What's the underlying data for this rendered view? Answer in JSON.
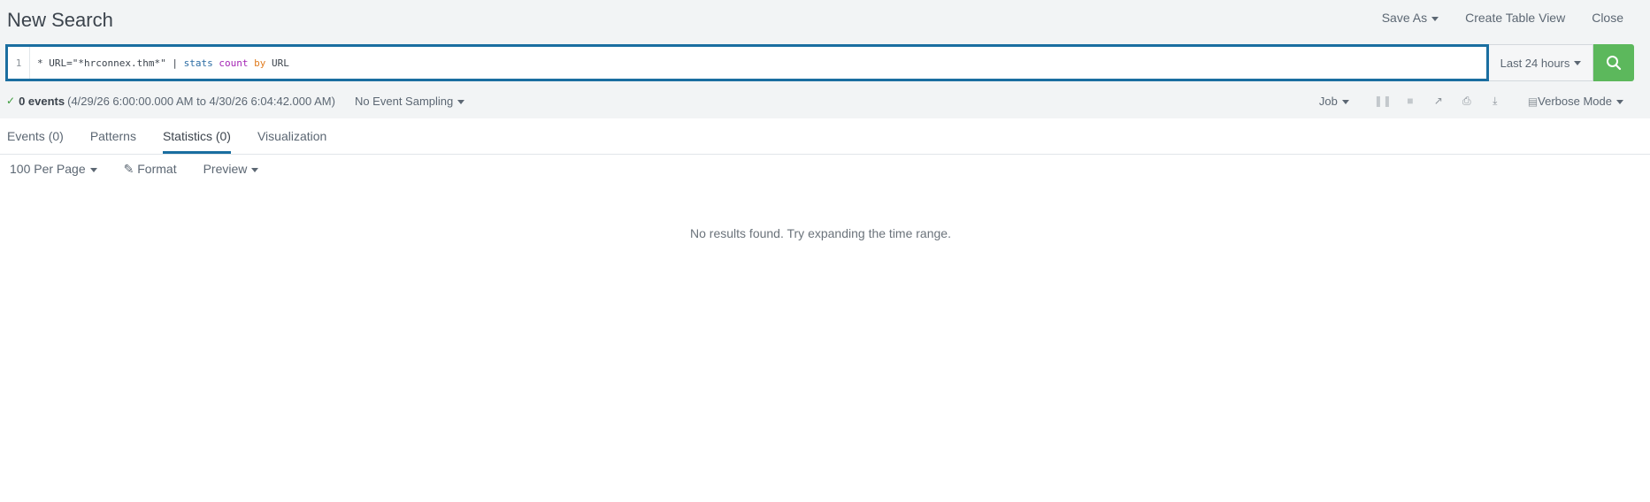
{
  "header": {
    "title": "New Search",
    "actions": [
      "Save As",
      "Create Table View",
      "Close"
    ]
  },
  "search": {
    "line_number": "1",
    "query_parts": [
      {
        "text": "* URL=\"*hrconnex.thm*\" | ",
        "type": "plain"
      },
      {
        "text": "stats",
        "type": "cmd"
      },
      {
        "text": " ",
        "type": "plain"
      },
      {
        "text": "count",
        "type": "fn"
      },
      {
        "text": " ",
        "type": "plain"
      },
      {
        "text": "by",
        "type": "kw"
      },
      {
        "text": " URL",
        "type": "plain"
      }
    ],
    "time_range": "Last 24 hours"
  },
  "status": {
    "events_count": "0 events",
    "time_span": "(4/29/26 6:00:00.000 AM to 4/30/26 6:04:42.000 AM)",
    "sampling": "No Event Sampling",
    "job": "Job",
    "mode": "Verbose Mode"
  },
  "tabs": [
    {
      "label": "Events (0)",
      "active": false
    },
    {
      "label": "Patterns",
      "active": false
    },
    {
      "label": "Statistics (0)",
      "active": true
    },
    {
      "label": "Visualization",
      "active": false
    }
  ],
  "toolbar": {
    "per_page": "100 Per Page",
    "format": "Format",
    "preview": "Preview"
  },
  "results": {
    "message": "No results found. Try expanding the time range."
  },
  "colors": {
    "accent": "#1a6ea0",
    "search_button": "#5cb85c",
    "success": "#3a9b3a"
  }
}
